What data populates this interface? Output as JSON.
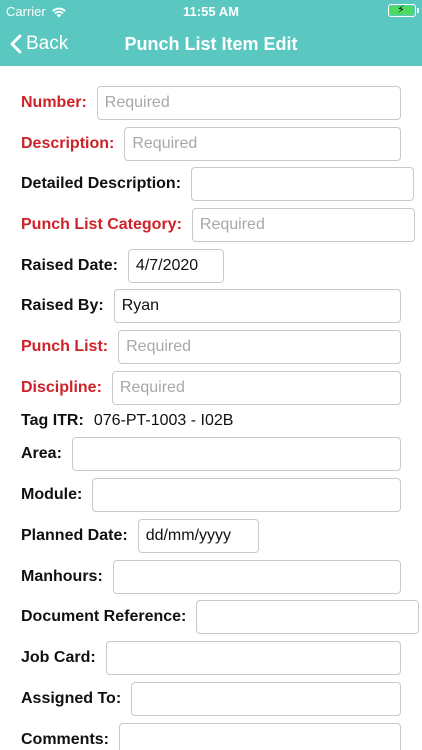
{
  "status": {
    "carrier": "Carrier",
    "time": "11:55 AM"
  },
  "nav": {
    "back_label": "Back",
    "title": "Punch List Item Edit"
  },
  "form": {
    "number": {
      "label": "Number:",
      "placeholder": "Required",
      "value": ""
    },
    "description": {
      "label": "Description:",
      "placeholder": "Required",
      "value": ""
    },
    "detailed_description": {
      "label": "Detailed Description:",
      "value": ""
    },
    "punch_list_category": {
      "label": "Punch List Category:",
      "placeholder": "Required",
      "value": ""
    },
    "raised_date": {
      "label": "Raised Date:",
      "value": "4/7/2020"
    },
    "raised_by": {
      "label": "Raised By:",
      "value": "Ryan"
    },
    "punch_list": {
      "label": "Punch List:",
      "placeholder": "Required",
      "value": ""
    },
    "discipline": {
      "label": "Discipline:",
      "placeholder": "Required",
      "value": ""
    },
    "tag_itr": {
      "label": "Tag ITR:",
      "value": "076-PT-1003 - I02B"
    },
    "area": {
      "label": "Area:",
      "value": ""
    },
    "module": {
      "label": "Module:",
      "value": ""
    },
    "planned_date": {
      "label": "Planned Date:",
      "value": "dd/mm/yyyy"
    },
    "manhours": {
      "label": "Manhours:",
      "value": ""
    },
    "document_reference": {
      "label": "Document Reference:",
      "value": ""
    },
    "job_card": {
      "label": "Job Card:",
      "value": ""
    },
    "assigned_to": {
      "label": "Assigned To:",
      "value": ""
    },
    "comments": {
      "label": "Comments:",
      "value": ""
    }
  },
  "colors": {
    "header": "#5ac8c0",
    "required_label": "#cc2229",
    "battery": "#4cd964"
  }
}
